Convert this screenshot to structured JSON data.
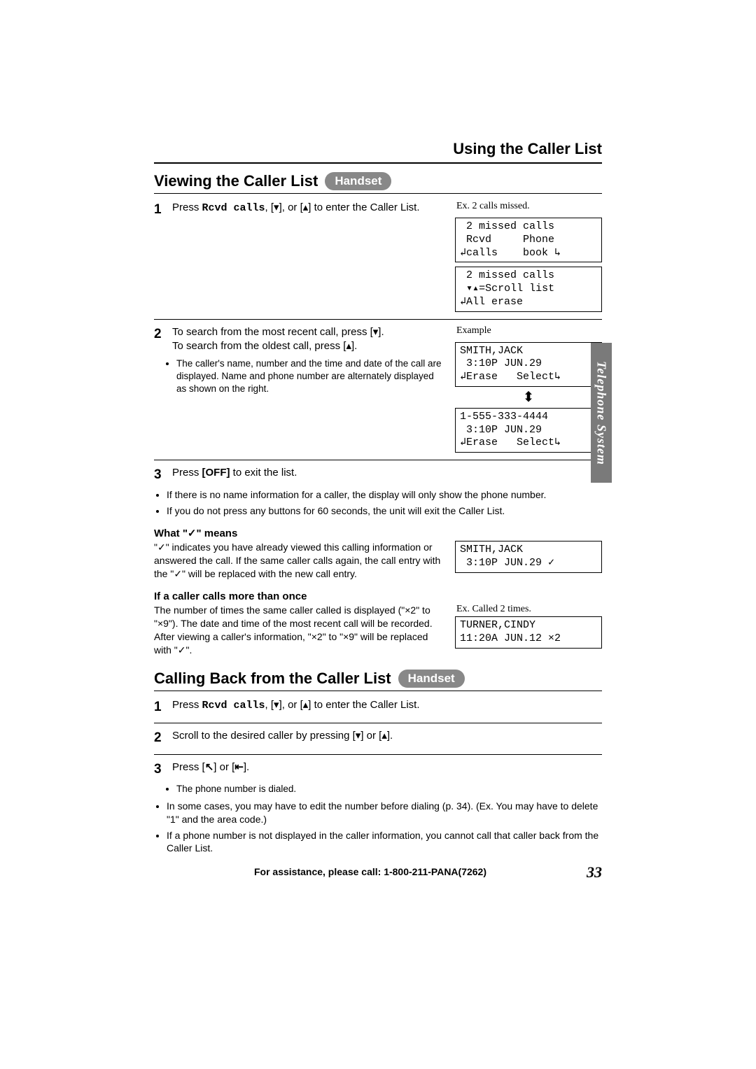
{
  "doc": {
    "title": "Using the Caller List",
    "side_tab": "Telephone System",
    "page_number": "33",
    "footer": "For assistance, please call: 1-800-211-PANA(7262)"
  },
  "sec1": {
    "title": "Viewing the Caller List",
    "badge": "Handset",
    "step1": {
      "num": "1",
      "pre": "Press ",
      "code": "Rcvd calls",
      "mid": ", [▾], or [▴] to enter the Caller List.",
      "caption": "Ex. 2 calls missed.",
      "lcd1": " 2 missed calls\n Rcvd     Phone\n↲calls    book ↳",
      "lcd2": " 2 missed calls\n ▾▴=Scroll list\n↲All erase"
    },
    "step2": {
      "num": "2",
      "line1": "To search from the most recent call, press [▾].",
      "line2": "To search from the oldest call, press [▴].",
      "bul1": "The caller's name, number and the time and date of the call are displayed. Name and phone number are alternately displayed as shown on the right.",
      "ex_caption": "Example",
      "lcd_name": "SMITH,JACK\n 3:10P JUN.29\n↲Erase   Select↳",
      "lcd_num": "1-555-333-4444\n 3:10P JUN.29\n↲Erase   Select↳"
    },
    "step3": {
      "num": "3",
      "pre": "Press ",
      "key": "[OFF]",
      "post": " to exit the list."
    },
    "notes": [
      "If there is no name information for a caller, the display will only show the phone number.",
      "If you do not press any buttons for 60 seconds, the unit will exit the Caller List."
    ],
    "checkmark": {
      "head": "What \"✓\" means",
      "body": "\"✓\" indicates you have already viewed this calling information or answered the call. If the same caller calls again, the call entry with the \"✓\" will be replaced with the new call entry.",
      "lcd": "SMITH,JACK\n 3:10P JUN.29 ✓"
    },
    "multi": {
      "head": "If a caller calls more than once",
      "body": "The number of times the same caller called is displayed (\"×2\" to \"×9\"). The date and time of the most recent call will be recorded. After viewing a caller's information, \"×2\" to \"×9\" will be replaced with \"✓\".",
      "caption": "Ex. Called 2 times.",
      "lcd": "TURNER,CINDY\n11:20A JUN.12 ×2"
    }
  },
  "sec2": {
    "title": "Calling Back from the Caller List",
    "badge": "Handset",
    "steps": {
      "s1": {
        "num": "1",
        "pre": "Press ",
        "code": "Rcvd calls",
        "post": ", [▾], or [▴] to enter the Caller List."
      },
      "s2": {
        "num": "2",
        "text": "Scroll to the desired caller by pressing [▾] or [▴]."
      },
      "s3": {
        "num": "3",
        "text_pre": "Press [",
        "icon1": "↖",
        "text_mid": "] or [",
        "icon2": "⇤",
        "text_post": "].",
        "sub": "The phone number is dialed."
      }
    },
    "notes": [
      "In some cases, you may have to edit the number before dialing (p. 34). (Ex. You may have to delete \"1\" and the area code.)",
      "If a phone number is not displayed in the caller information, you cannot call that caller back from the Caller List."
    ]
  }
}
